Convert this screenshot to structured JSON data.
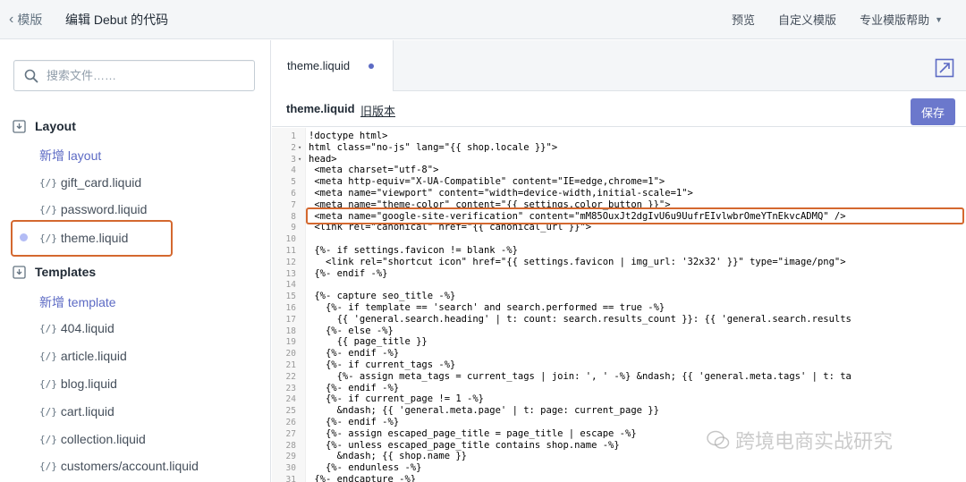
{
  "topbar": {
    "back_label": "模版",
    "title": "编辑 Debut 的代码",
    "links": [
      "预览",
      "自定义模版",
      "专业模版帮助"
    ]
  },
  "sidebar": {
    "search_placeholder": "搜索文件……",
    "sections": [
      {
        "title": "Layout",
        "add_label": "新增 layout",
        "files": [
          "gift_card.liquid",
          "password.liquid",
          "theme.liquid"
        ]
      },
      {
        "title": "Templates",
        "add_label": "新增 template",
        "files": [
          "404.liquid",
          "article.liquid",
          "blog.liquid",
          "cart.liquid",
          "collection.liquid",
          "customers/account.liquid"
        ]
      }
    ],
    "file_icon_text": "{/}"
  },
  "editor": {
    "tab_label": "theme.liquid",
    "file_label": "theme.liquid",
    "old_version_label": "旧版本",
    "save_label": "保存",
    "code_lines": [
      {
        "n": "1",
        "fold": "",
        "t": "!doctype html>"
      },
      {
        "n": "2",
        "fold": "▾",
        "t": "html class=\"no-js\" lang=\"{{ shop.locale }}\">"
      },
      {
        "n": "3",
        "fold": "▾",
        "t": "head>"
      },
      {
        "n": "4",
        "fold": "",
        "t": " <meta charset=\"utf-8\">"
      },
      {
        "n": "5",
        "fold": "",
        "t": " <meta http-equiv=\"X-UA-Compatible\" content=\"IE=edge,chrome=1\">"
      },
      {
        "n": "6",
        "fold": "",
        "t": " <meta name=\"viewport\" content=\"width=device-width,initial-scale=1\">"
      },
      {
        "n": "7",
        "fold": "",
        "t": " <meta name=\"theme-color\" content=\"{{ settings.color_button }}\">"
      },
      {
        "n": "8",
        "fold": "",
        "t": " <meta name=\"google-site-verification\" content=\"mM85OuxJt2dgIvU6u9UufrEIvlwbrOmeYTnEkvcADMQ\" />"
      },
      {
        "n": "9",
        "fold": "",
        "t": " <link rel=\"canonical\" href=\"{{ canonical_url }}\">"
      },
      {
        "n": "10",
        "fold": "",
        "t": ""
      },
      {
        "n": "11",
        "fold": "",
        "t": " {%- if settings.favicon != blank -%}"
      },
      {
        "n": "12",
        "fold": "",
        "t": "   <link rel=\"shortcut icon\" href=\"{{ settings.favicon | img_url: '32x32' }}\" type=\"image/png\">"
      },
      {
        "n": "13",
        "fold": "",
        "t": " {%- endif -%}"
      },
      {
        "n": "14",
        "fold": "",
        "t": ""
      },
      {
        "n": "15",
        "fold": "",
        "t": " {%- capture seo_title -%}"
      },
      {
        "n": "16",
        "fold": "",
        "t": "   {%- if template == 'search' and search.performed == true -%}"
      },
      {
        "n": "17",
        "fold": "",
        "t": "     {{ 'general.search.heading' | t: count: search.results_count }}: {{ 'general.search.results"
      },
      {
        "n": "18",
        "fold": "",
        "t": "   {%- else -%}"
      },
      {
        "n": "19",
        "fold": "",
        "t": "     {{ page_title }}"
      },
      {
        "n": "20",
        "fold": "",
        "t": "   {%- endif -%}"
      },
      {
        "n": "21",
        "fold": "",
        "t": "   {%- if current_tags -%}"
      },
      {
        "n": "22",
        "fold": "",
        "t": "     {%- assign meta_tags = current_tags | join: ', ' -%} &ndash; {{ 'general.meta.tags' | t: ta"
      },
      {
        "n": "23",
        "fold": "",
        "t": "   {%- endif -%}"
      },
      {
        "n": "24",
        "fold": "",
        "t": "   {%- if current_page != 1 -%}"
      },
      {
        "n": "25",
        "fold": "",
        "t": "     &ndash; {{ 'general.meta.page' | t: page: current_page }}"
      },
      {
        "n": "26",
        "fold": "",
        "t": "   {%- endif -%}"
      },
      {
        "n": "27",
        "fold": "",
        "t": "   {%- assign escaped_page_title = page_title | escape -%}"
      },
      {
        "n": "28",
        "fold": "",
        "t": "   {%- unless escaped_page_title contains shop.name -%}"
      },
      {
        "n": "29",
        "fold": "",
        "t": "     &ndash; {{ shop.name }}"
      },
      {
        "n": "30",
        "fold": "",
        "t": "   {%- endunless -%}"
      },
      {
        "n": "31",
        "fold": "",
        "t": " {%- endcapture -%}"
      }
    ]
  },
  "watermark": "跨境电商实战研究",
  "colors": {
    "accent": "#5c6ac4",
    "highlight": "#d4682f",
    "save_button": "#6b78cc"
  }
}
